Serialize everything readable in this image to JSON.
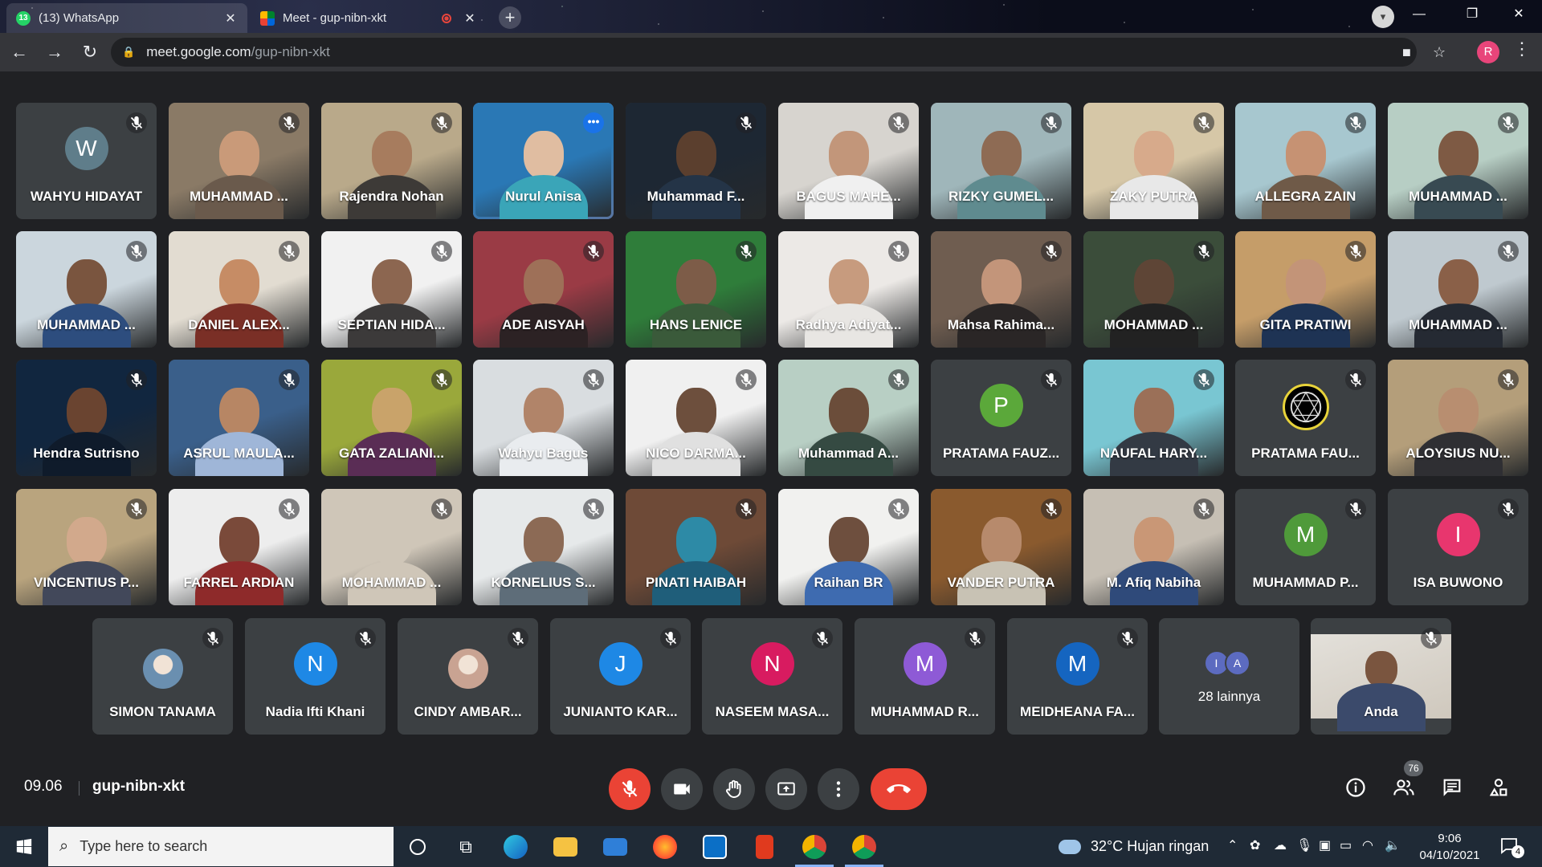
{
  "browser": {
    "tabs": [
      {
        "title": "(13) WhatsApp",
        "badge": "13",
        "active": false
      },
      {
        "title": "Meet - gup-nibn-xkt",
        "active": true
      }
    ],
    "url_host": "meet.google.com",
    "url_path": "/gup-nibn-xkt",
    "user_initial": "R"
  },
  "meet": {
    "time": "09.06",
    "code": "gup-nibn-xkt",
    "people_count": "76",
    "tiles": [
      {
        "name": "WAHYU HIDAYAT",
        "initial": "W",
        "color": "#5f7d8a"
      },
      {
        "name": "MUHAMMAD ...",
        "bg": "#8a7a66",
        "skin": "#c99a79",
        "shirt": "#6a5a4c"
      },
      {
        "name": "Rajendra Nohan",
        "bg": "#b9a98a",
        "skin": "#a77c5e",
        "shirt": "#3d3a37"
      },
      {
        "name": "Nurul Anisa",
        "bg": "#2a78b5",
        "skin": "#e0bda1",
        "shirt": "#3aa5b8",
        "speaking": true
      },
      {
        "name": "Muhammad F...",
        "bg": "#1d2733",
        "skin": "#5b3f2e",
        "shirt": "#243447"
      },
      {
        "name": "BAGUS MAHE...",
        "bg": "#d7d4cf",
        "skin": "#c2967a",
        "shirt": "#f0f0f0"
      },
      {
        "name": "RIZKY GUMEL...",
        "bg": "#9fb6ba",
        "skin": "#8e6b54",
        "shirt": "#5f8b8f"
      },
      {
        "name": "ZAKY PUTRA",
        "bg": "#d6c7a7",
        "skin": "#d7aa8b",
        "shirt": "#e8e8e8"
      },
      {
        "name": "ALLEGRA ZAIN",
        "bg": "#a7c7cf",
        "skin": "#c69273",
        "shirt": "#6f5a48"
      },
      {
        "name": "MUHAMMAD ...",
        "bg": "#b7cec4",
        "skin": "#7e5a44",
        "shirt": "#384a52"
      },
      {
        "name": "MUHAMMAD ...",
        "bg": "#cbd6dd",
        "skin": "#7a553f",
        "shirt": "#2d4d7e"
      },
      {
        "name": "DANIEL ALEX...",
        "bg": "#e2dcd1",
        "skin": "#c68c65",
        "shirt": "#7a2f26"
      },
      {
        "name": "SEPTIAN HIDA...",
        "bg": "#f1f1f1",
        "skin": "#8c6650",
        "shirt": "#3c3a3a"
      },
      {
        "name": "ADE AISYAH",
        "bg": "#9a3b45",
        "skin": "#9e7058",
        "shirt": "#2c2224"
      },
      {
        "name": "HANS LENICE",
        "bg": "#2f7d3a",
        "skin": "#7d5c48",
        "shirt": "#3a5a3a"
      },
      {
        "name": "Radhya Adiyat...",
        "bg": "#ece9e6",
        "skin": "#c79b7e",
        "shirt": "#e8e6e3"
      },
      {
        "name": "Mahsa Rahima...",
        "bg": "#6f5d50",
        "skin": "#c3957a",
        "shirt": "#2a2626"
      },
      {
        "name": "MOHAMMAD ...",
        "bg": "#3b4d3a",
        "skin": "#5e4536",
        "shirt": "#222"
      },
      {
        "name": "GITA PRATIWI",
        "bg": "#c59d69",
        "skin": "#c39478",
        "shirt": "#1e3354"
      },
      {
        "name": "MUHAMMAD ...",
        "bg": "#bfc9cf",
        "skin": "#8a6048",
        "shirt": "#252a33"
      },
      {
        "name": "Hendra Sutrisno",
        "bg": "#11263f",
        "skin": "#6a4430",
        "shirt": "#0f1b2b"
      },
      {
        "name": "ASRUL MAULA...",
        "bg": "#3a5f8a",
        "skin": "#b78664",
        "shirt": "#9fb6d8"
      },
      {
        "name": "GATA ZALIANI...",
        "bg": "#9aa83b",
        "skin": "#c9a36a",
        "shirt": "#5a2d55"
      },
      {
        "name": "Wahyu Bagus",
        "bg": "#d9dde0",
        "skin": "#b18469",
        "shirt": "#e9ecef"
      },
      {
        "name": "NICO DARMA...",
        "bg": "#f0f0f0",
        "skin": "#6d4f3d",
        "shirt": "#e0e0e0"
      },
      {
        "name": "Muhammad A...",
        "bg": "#b8cfc4",
        "skin": "#6b4d3a",
        "shirt": "#354a42"
      },
      {
        "name": "PRATAMA FAUZ...",
        "initial": "P",
        "color": "#5ba83a"
      },
      {
        "name": "NAUFAL HARY...",
        "bg": "#79c6d2",
        "skin": "#9b7058",
        "shirt": "#333a44"
      },
      {
        "name": "PRATAMA FAU...",
        "logo": true,
        "bg": "#202124"
      },
      {
        "name": "ALOYSIUS NU...",
        "bg": "#b49e7a",
        "skin": "#b88e70",
        "shirt": "#2f2f33"
      },
      {
        "name": "VINCENTIUS P...",
        "bg": "#b9a47e",
        "skin": "#d2a98c",
        "shirt": "#42485a"
      },
      {
        "name": "FARREL ARDIAN",
        "bg": "#ededed",
        "skin": "#7a4a3a",
        "shirt": "#8e2a2a"
      },
      {
        "name": "MOHAMMAD ...",
        "bg": "#cfc6b8",
        "skin": "#cfc6b8",
        "shirt": "#cfc6b8"
      },
      {
        "name": "KORNELIUS S...",
        "bg": "#e6e9ea",
        "skin": "#8c6a55",
        "shirt": "#5e6d79"
      },
      {
        "name": "PINATI HAIBAH",
        "bg": "#6e4a37",
        "skin": "#2d8aa6",
        "shirt": "#1f5e7a"
      },
      {
        "name": "Raihan BR",
        "bg": "#f1f1ef",
        "skin": "#6e4f3e",
        "shirt": "#3e6bb0"
      },
      {
        "name": "VANDER PUTRA",
        "bg": "#8a5a2e",
        "skin": "#b78a6c",
        "shirt": "#c8c2b4"
      },
      {
        "name": "M. Afiq Nabiha",
        "bg": "#c6bfb4",
        "skin": "#c99776",
        "shirt": "#2f4a7a"
      },
      {
        "name": "MUHAMMAD P...",
        "initial": "M",
        "color": "#4f9a3a"
      },
      {
        "name": "ISA BUWONO",
        "initial": "I",
        "color": "#e8366e"
      }
    ],
    "bottom_tiles": [
      {
        "name": "SIMON TANAMA",
        "photo": "#6a8fb0"
      },
      {
        "name": "Nadia Ifti Khani",
        "initial": "N",
        "color": "#1e88e5"
      },
      {
        "name": "CINDY AMBAR...",
        "photo": "#c9a392"
      },
      {
        "name": "JUNIANTO KAR...",
        "initial": "J",
        "color": "#1e88e5"
      },
      {
        "name": "NASEEM MASA...",
        "initial": "N",
        "color": "#d81b60"
      },
      {
        "name": "MUHAMMAD R...",
        "initial": "M",
        "color": "#8e5ad6"
      },
      {
        "name": "MEIDHEANA FA...",
        "initial": "M",
        "color": "#1565c0"
      }
    ],
    "others": {
      "label": "28 lainnya",
      "avatars": [
        "I",
        "A"
      ]
    },
    "self_tile": {
      "name": "Anda"
    }
  },
  "taskbar": {
    "search_placeholder": "Type here to search",
    "weather": "32°C  Hujan ringan",
    "time": "9:06",
    "date": "04/10/2021",
    "notifications": "4"
  },
  "icons": {
    "mic_off": "mic-off-icon",
    "camera": "camera-icon",
    "raise_hand": "hand-icon",
    "present": "present-icon",
    "more": "more-vert-icon",
    "end_call": "end-call-icon",
    "info": "info-icon",
    "people": "people-icon",
    "chat": "chat-icon",
    "activities": "activities-icon"
  },
  "colors": {
    "meet_bg": "#202124",
    "tile_bg": "#3c4043",
    "red": "#ea4335",
    "accent": "#8ab4f8"
  }
}
